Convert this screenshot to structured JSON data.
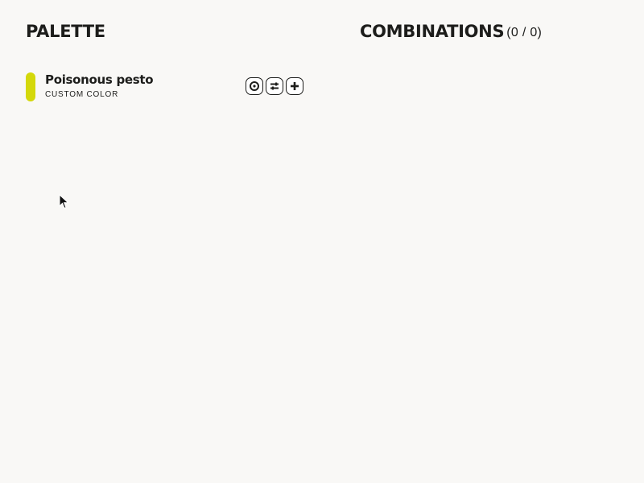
{
  "palette": {
    "title": "PALETTE",
    "colors": [
      {
        "name": "Poisonous pesto",
        "type": "CUSTOM COLOR",
        "swatch_color": "#d4d80a",
        "actions": [
          {
            "icon": "eye-icon",
            "label": "Preview"
          },
          {
            "icon": "sliders-icon",
            "label": "Adjust"
          },
          {
            "icon": "plus-icon",
            "label": "Add"
          }
        ]
      }
    ]
  },
  "combinations": {
    "title": "COMBINATIONS",
    "count": "(0 / 0)"
  },
  "colors": {
    "background": "#f9f8f6",
    "text": "#1d1d1b"
  }
}
